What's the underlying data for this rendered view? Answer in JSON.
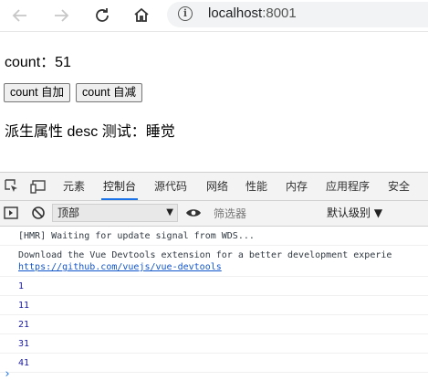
{
  "browser": {
    "address_host": "localhost",
    "address_port": ":8001"
  },
  "page": {
    "count_text": "count：51",
    "increment_label": "count 自加",
    "decrement_label": "count 自减",
    "desc_text": "派生属性 desc 测试：睡觉"
  },
  "devtools": {
    "tabs": [
      "元素",
      "控制台",
      "源代码",
      "网络",
      "性能",
      "内存",
      "应用程序",
      "安全"
    ],
    "active_tab": "控制台",
    "context": "顶部",
    "filter_placeholder": "筛选器",
    "level": "默认级别 ▼",
    "messages": {
      "hmr": "[HMR] Waiting for update signal from WDS...",
      "vue_devtools": "Download the Vue Devtools extension for a better development experie",
      "vue_link": "https://github.com/vuejs/vue-devtools",
      "numbers": [
        "1",
        "11",
        "21",
        "31",
        "41"
      ]
    }
  }
}
